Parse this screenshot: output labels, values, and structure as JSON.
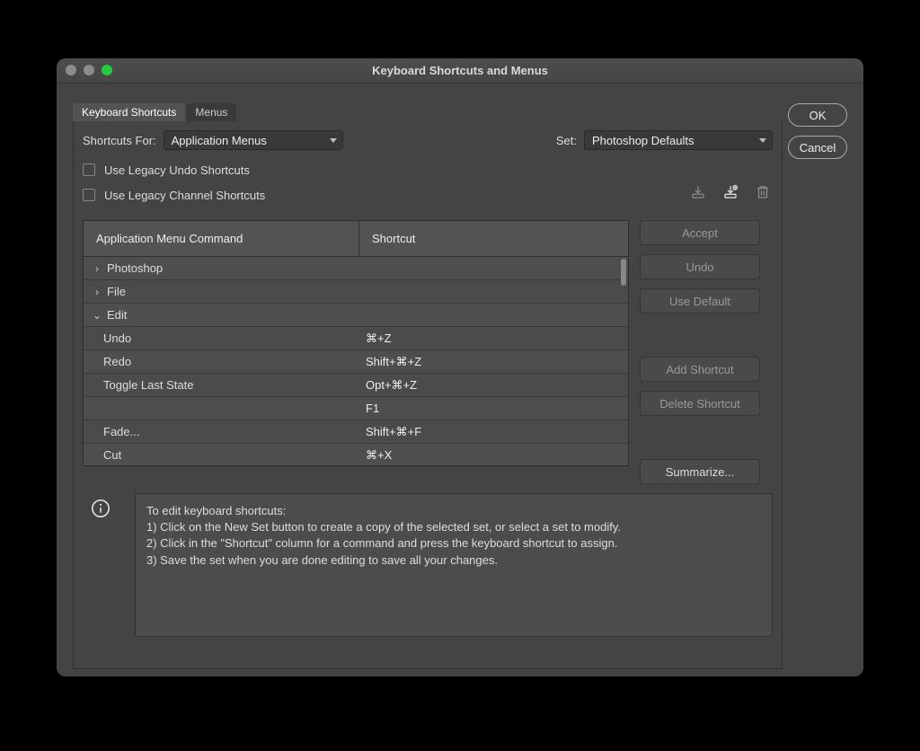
{
  "title": "Keyboard Shortcuts and Menus",
  "tabs": {
    "shortcuts": "Keyboard Shortcuts",
    "menus": "Menus"
  },
  "labels": {
    "shortcuts_for": "Shortcuts For:",
    "set": "Set:",
    "legacy_undo": "Use Legacy Undo Shortcuts",
    "legacy_channel": "Use Legacy Channel Shortcuts"
  },
  "selects": {
    "shortcuts_for_value": "Application Menus",
    "set_value": "Photoshop Defaults"
  },
  "columns": {
    "command": "Application Menu Command",
    "shortcut": "Shortcut"
  },
  "rows": [
    {
      "name": "Photoshop",
      "shortcut": "",
      "type": "group",
      "expanded": false
    },
    {
      "name": "File",
      "shortcut": "",
      "type": "group",
      "expanded": false
    },
    {
      "name": "Edit",
      "shortcut": "",
      "type": "group",
      "expanded": true
    },
    {
      "name": "Undo",
      "shortcut": "⌘+Z",
      "type": "item"
    },
    {
      "name": "Redo",
      "shortcut": "Shift+⌘+Z",
      "type": "item"
    },
    {
      "name": "Toggle Last State",
      "shortcut": "Opt+⌘+Z",
      "type": "item"
    },
    {
      "name": "",
      "shortcut": "F1",
      "type": "item"
    },
    {
      "name": "Fade...",
      "shortcut": "Shift+⌘+F",
      "type": "item"
    },
    {
      "name": "Cut",
      "shortcut": "⌘+X",
      "type": "item"
    }
  ],
  "buttons": {
    "ok": "OK",
    "cancel": "Cancel",
    "accept": "Accept",
    "undo": "Undo",
    "use_default": "Use Default",
    "add_shortcut": "Add Shortcut",
    "delete_shortcut": "Delete Shortcut",
    "summarize": "Summarize..."
  },
  "help": {
    "heading": "To edit keyboard shortcuts:",
    "l1": "1) Click on the New Set button to create a copy of the selected set, or select a set to modify.",
    "l2": "2) Click in the \"Shortcut\" column for a command and press the keyboard shortcut to assign.",
    "l3": "3) Save the set when you are done editing to save all your changes."
  }
}
